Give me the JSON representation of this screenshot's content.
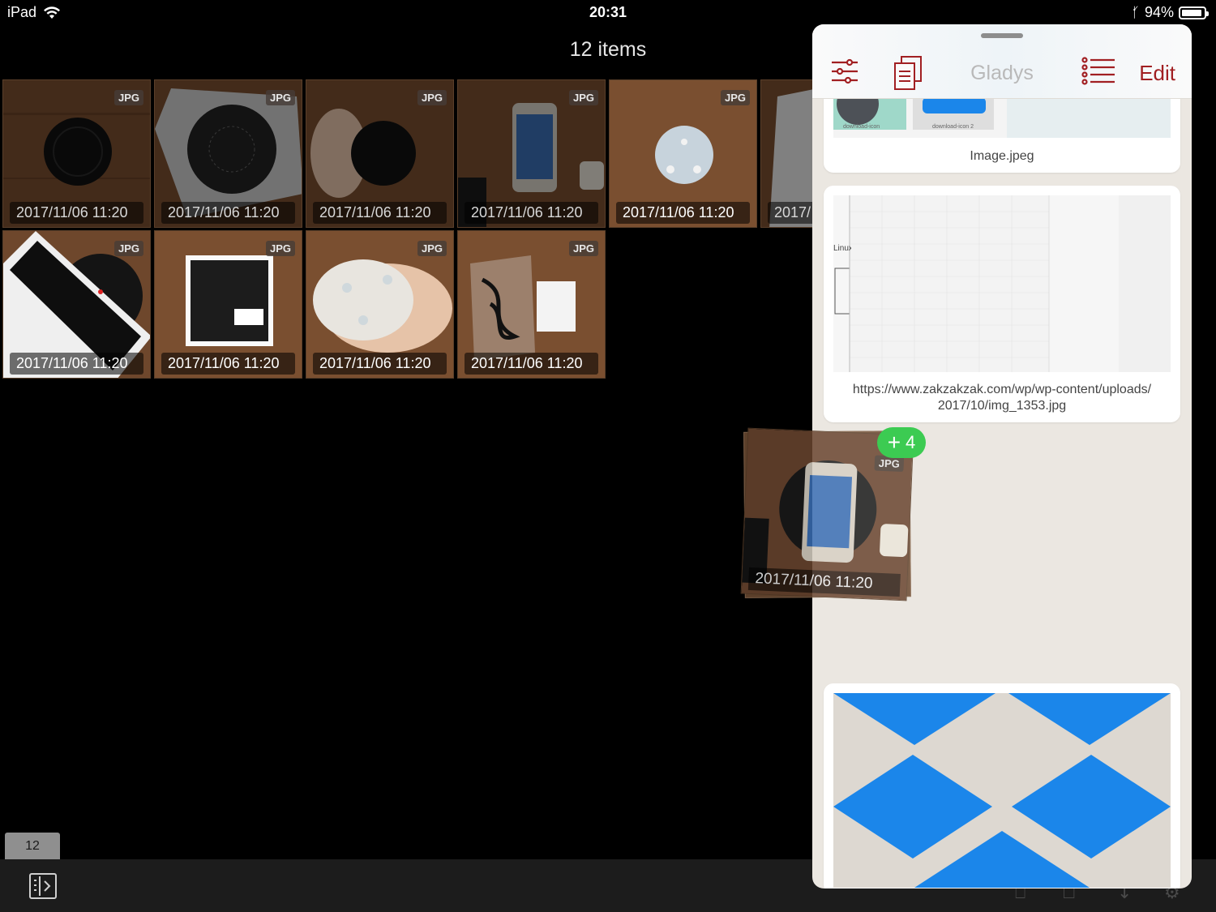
{
  "status": {
    "device": "iPad",
    "time": "20:31",
    "battery": "94%",
    "battery_level": 0.94
  },
  "title": "12 items",
  "grid": {
    "tiles": [
      {
        "badge": "JPG",
        "date": "2017/11/06 11:20",
        "subject": "black-pad",
        "dim": true
      },
      {
        "badge": "JPG",
        "date": "2017/11/06 11:20",
        "subject": "box-pad",
        "dim": true
      },
      {
        "badge": "JPG",
        "date": "2017/11/06 11:20",
        "subject": "hand-pad",
        "dim": true
      },
      {
        "badge": "JPG",
        "date": "2017/11/06 11:20",
        "subject": "phone",
        "dim": true
      },
      {
        "badge": "JPG",
        "date": "2017/11/06 11:20",
        "subject": "white-pad",
        "dim": false
      },
      {
        "badge": "",
        "date": "2017/",
        "subject": "white-phone",
        "dim": true
      },
      {
        "badge": "JPG",
        "date": "2017/11/06 11:20",
        "subject": "phone-on-pad",
        "dim": false
      },
      {
        "badge": "JPG",
        "date": "2017/11/06 11:20",
        "subject": "box",
        "dim": false
      },
      {
        "badge": "JPG",
        "date": "2017/11/06 11:20",
        "subject": "hand-white-pad",
        "dim": false
      },
      {
        "badge": "JPG",
        "date": "2017/11/06 11:20",
        "subject": "cable-bag",
        "dim": false
      }
    ]
  },
  "toolbar": {
    "count": "12"
  },
  "gladys": {
    "title": "Gladys",
    "edit_label": "Edit",
    "items": [
      {
        "caption": "Image.jpeg",
        "thumb_labels": [
          "download-icon",
          "download-icon 2"
        ]
      },
      {
        "caption_line1": "https://www.zakzakzak.com/wp/wp-content/uploads/",
        "caption_line2": "2017/10/img_1353.jpg",
        "sketch_text": "Linux"
      },
      {
        "caption": ""
      }
    ]
  },
  "drag": {
    "badge": "JPG",
    "date": "2017/11/06 11:20",
    "count_badge": "4"
  },
  "colors": {
    "accent": "#a11f22",
    "drop_badge": "#3ccb52",
    "dropbox_blue": "#1b86ea"
  }
}
